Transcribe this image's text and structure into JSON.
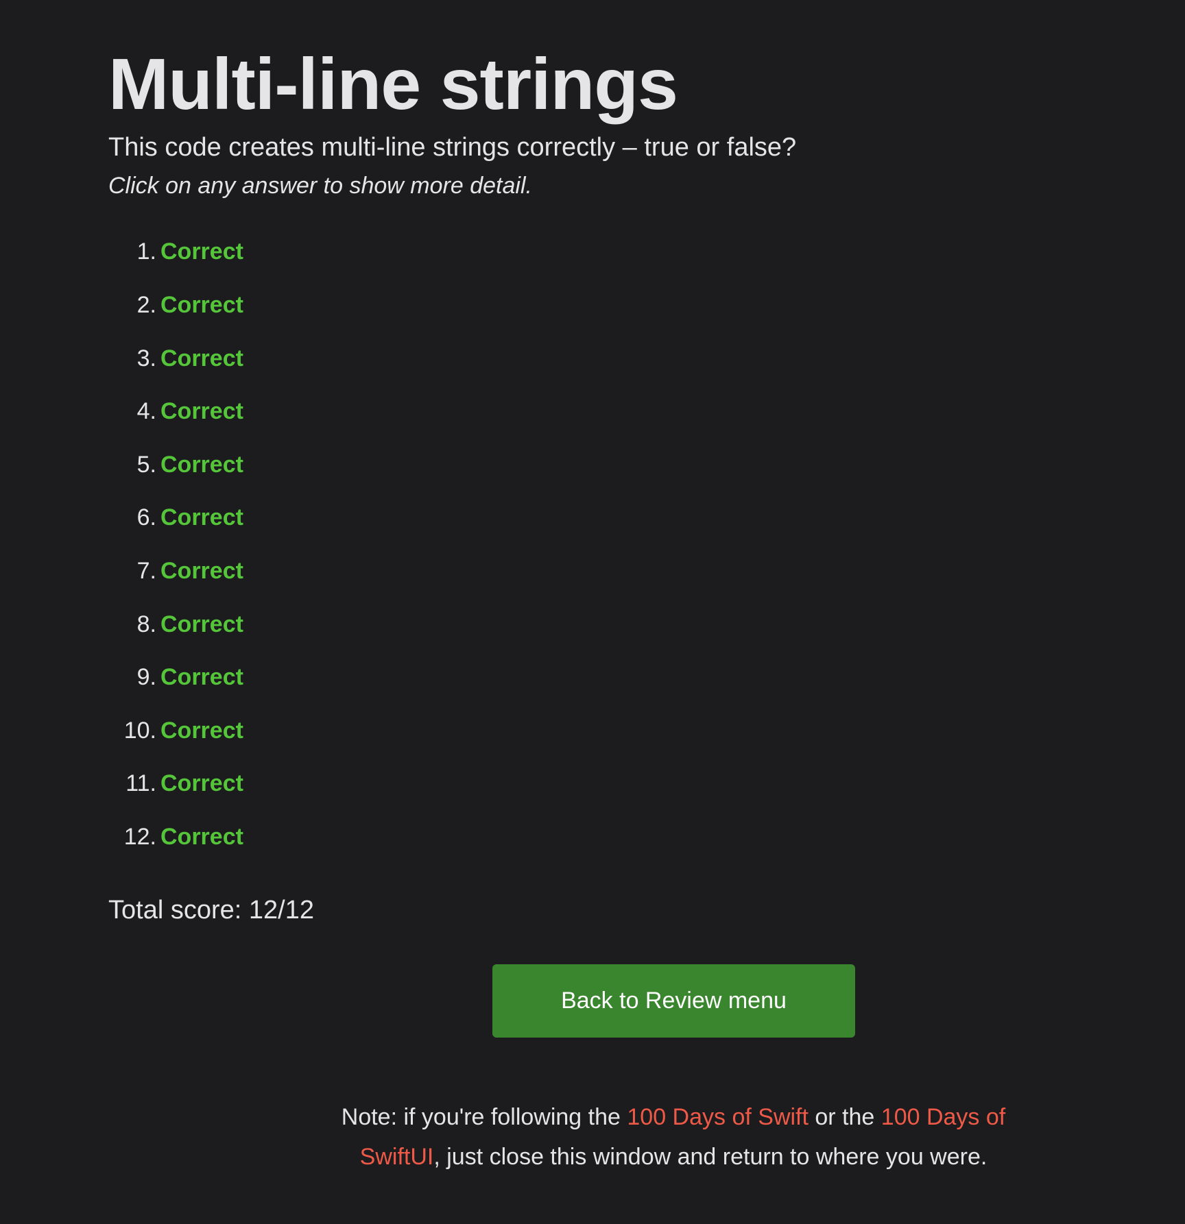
{
  "header": {
    "title": "Multi-line strings",
    "question": "This code creates multi-line strings correctly – true or false?",
    "hint": "Click on any answer to show more detail."
  },
  "answers": [
    {
      "number": "1.",
      "result": "Correct"
    },
    {
      "number": "2.",
      "result": "Correct"
    },
    {
      "number": "3.",
      "result": "Correct"
    },
    {
      "number": "4.",
      "result": "Correct"
    },
    {
      "number": "5.",
      "result": "Correct"
    },
    {
      "number": "6.",
      "result": "Correct"
    },
    {
      "number": "7.",
      "result": "Correct"
    },
    {
      "number": "8.",
      "result": "Correct"
    },
    {
      "number": "9.",
      "result": "Correct"
    },
    {
      "number": "10.",
      "result": "Correct"
    },
    {
      "number": "11.",
      "result": "Correct"
    },
    {
      "number": "12.",
      "result": "Correct"
    }
  ],
  "score": {
    "text": "Total score: 12/12"
  },
  "back_button": {
    "label": "Back to Review menu"
  },
  "note": {
    "prefix": "Note: if you're following the ",
    "link1": "100 Days of Swift",
    "middle": " or the ",
    "link2": "100 Days of SwiftUI",
    "suffix": ", just close this window and return to where you were."
  },
  "colors": {
    "background": "#1c1c1e",
    "text": "#e5e5e7",
    "correct": "#55c63a",
    "button": "#3a862e",
    "link": "#ef5a48"
  }
}
